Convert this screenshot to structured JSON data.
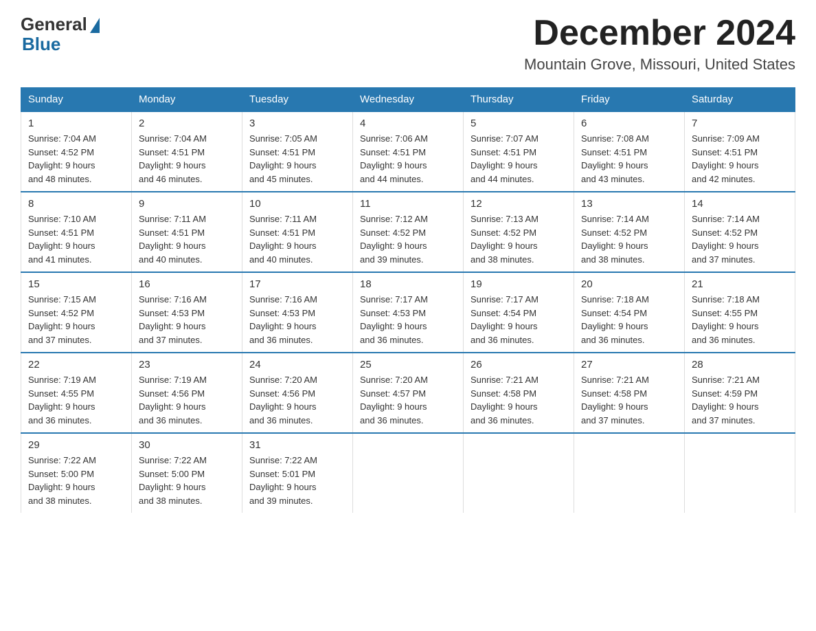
{
  "logo": {
    "general": "General",
    "blue": "Blue"
  },
  "title": "December 2024",
  "subtitle": "Mountain Grove, Missouri, United States",
  "weekdays": [
    "Sunday",
    "Monday",
    "Tuesday",
    "Wednesday",
    "Thursday",
    "Friday",
    "Saturday"
  ],
  "weeks": [
    [
      {
        "day": "1",
        "sunrise": "7:04 AM",
        "sunset": "4:52 PM",
        "daylight": "9 hours and 48 minutes."
      },
      {
        "day": "2",
        "sunrise": "7:04 AM",
        "sunset": "4:51 PM",
        "daylight": "9 hours and 46 minutes."
      },
      {
        "day": "3",
        "sunrise": "7:05 AM",
        "sunset": "4:51 PM",
        "daylight": "9 hours and 45 minutes."
      },
      {
        "day": "4",
        "sunrise": "7:06 AM",
        "sunset": "4:51 PM",
        "daylight": "9 hours and 44 minutes."
      },
      {
        "day": "5",
        "sunrise": "7:07 AM",
        "sunset": "4:51 PM",
        "daylight": "9 hours and 44 minutes."
      },
      {
        "day": "6",
        "sunrise": "7:08 AM",
        "sunset": "4:51 PM",
        "daylight": "9 hours and 43 minutes."
      },
      {
        "day": "7",
        "sunrise": "7:09 AM",
        "sunset": "4:51 PM",
        "daylight": "9 hours and 42 minutes."
      }
    ],
    [
      {
        "day": "8",
        "sunrise": "7:10 AM",
        "sunset": "4:51 PM",
        "daylight": "9 hours and 41 minutes."
      },
      {
        "day": "9",
        "sunrise": "7:11 AM",
        "sunset": "4:51 PM",
        "daylight": "9 hours and 40 minutes."
      },
      {
        "day": "10",
        "sunrise": "7:11 AM",
        "sunset": "4:51 PM",
        "daylight": "9 hours and 40 minutes."
      },
      {
        "day": "11",
        "sunrise": "7:12 AM",
        "sunset": "4:52 PM",
        "daylight": "9 hours and 39 minutes."
      },
      {
        "day": "12",
        "sunrise": "7:13 AM",
        "sunset": "4:52 PM",
        "daylight": "9 hours and 38 minutes."
      },
      {
        "day": "13",
        "sunrise": "7:14 AM",
        "sunset": "4:52 PM",
        "daylight": "9 hours and 38 minutes."
      },
      {
        "day": "14",
        "sunrise": "7:14 AM",
        "sunset": "4:52 PM",
        "daylight": "9 hours and 37 minutes."
      }
    ],
    [
      {
        "day": "15",
        "sunrise": "7:15 AM",
        "sunset": "4:52 PM",
        "daylight": "9 hours and 37 minutes."
      },
      {
        "day": "16",
        "sunrise": "7:16 AM",
        "sunset": "4:53 PM",
        "daylight": "9 hours and 37 minutes."
      },
      {
        "day": "17",
        "sunrise": "7:16 AM",
        "sunset": "4:53 PM",
        "daylight": "9 hours and 36 minutes."
      },
      {
        "day": "18",
        "sunrise": "7:17 AM",
        "sunset": "4:53 PM",
        "daylight": "9 hours and 36 minutes."
      },
      {
        "day": "19",
        "sunrise": "7:17 AM",
        "sunset": "4:54 PM",
        "daylight": "9 hours and 36 minutes."
      },
      {
        "day": "20",
        "sunrise": "7:18 AM",
        "sunset": "4:54 PM",
        "daylight": "9 hours and 36 minutes."
      },
      {
        "day": "21",
        "sunrise": "7:18 AM",
        "sunset": "4:55 PM",
        "daylight": "9 hours and 36 minutes."
      }
    ],
    [
      {
        "day": "22",
        "sunrise": "7:19 AM",
        "sunset": "4:55 PM",
        "daylight": "9 hours and 36 minutes."
      },
      {
        "day": "23",
        "sunrise": "7:19 AM",
        "sunset": "4:56 PM",
        "daylight": "9 hours and 36 minutes."
      },
      {
        "day": "24",
        "sunrise": "7:20 AM",
        "sunset": "4:56 PM",
        "daylight": "9 hours and 36 minutes."
      },
      {
        "day": "25",
        "sunrise": "7:20 AM",
        "sunset": "4:57 PM",
        "daylight": "9 hours and 36 minutes."
      },
      {
        "day": "26",
        "sunrise": "7:21 AM",
        "sunset": "4:58 PM",
        "daylight": "9 hours and 36 minutes."
      },
      {
        "day": "27",
        "sunrise": "7:21 AM",
        "sunset": "4:58 PM",
        "daylight": "9 hours and 37 minutes."
      },
      {
        "day": "28",
        "sunrise": "7:21 AM",
        "sunset": "4:59 PM",
        "daylight": "9 hours and 37 minutes."
      }
    ],
    [
      {
        "day": "29",
        "sunrise": "7:22 AM",
        "sunset": "5:00 PM",
        "daylight": "9 hours and 38 minutes."
      },
      {
        "day": "30",
        "sunrise": "7:22 AM",
        "sunset": "5:00 PM",
        "daylight": "9 hours and 38 minutes."
      },
      {
        "day": "31",
        "sunrise": "7:22 AM",
        "sunset": "5:01 PM",
        "daylight": "9 hours and 39 minutes."
      },
      null,
      null,
      null,
      null
    ]
  ],
  "labels": {
    "sunrise": "Sunrise:",
    "sunset": "Sunset:",
    "daylight": "Daylight:"
  }
}
